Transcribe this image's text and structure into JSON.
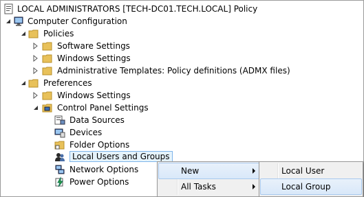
{
  "tree": {
    "root": "LOCAL ADMINISTRATORS [TECH-DC01.TECH.LOCAL] Policy",
    "computer_configuration": "Computer Configuration",
    "policies": "Policies",
    "software_settings": "Software Settings",
    "windows_settings_policies": "Windows Settings",
    "admin_templates": "Administrative Templates: Policy definitions (ADMX files)",
    "preferences": "Preferences",
    "windows_settings_prefs": "Windows Settings",
    "control_panel_settings": "Control Panel Settings",
    "data_sources": "Data Sources",
    "devices": "Devices",
    "folder_options": "Folder Options",
    "local_users_groups": "Local Users and Groups",
    "network_options": "Network Options",
    "power_options": "Power Options"
  },
  "context_menu": {
    "new": "New",
    "all_tasks": "All Tasks"
  },
  "submenu": {
    "local_user": "Local User",
    "local_group": "Local Group"
  },
  "colors": {
    "folder": "#e8c15a",
    "selection_border": "#7eb4ea",
    "selection_fill": "#e5f3fb",
    "menu_bg": "#f0f0f0"
  }
}
